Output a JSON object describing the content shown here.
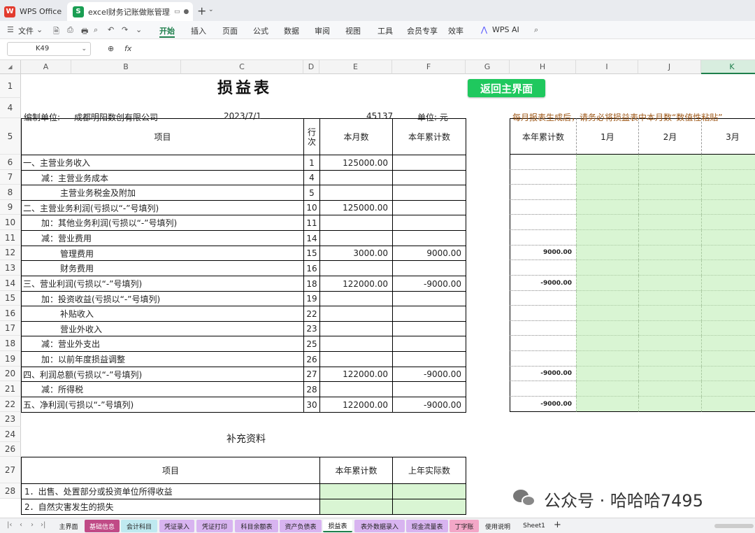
{
  "titlebar": {
    "app_tab": "WPS Office",
    "app_logo": "W",
    "doc_logo": "S",
    "doc_tab": "excel财务记账做账管理系统",
    "icons": [
      "monitor-icon",
      "dot-icon",
      "plus-icon",
      "chevron-down-icon"
    ]
  },
  "menu": {
    "file": "文件",
    "items": [
      "开始",
      "插入",
      "页面",
      "公式",
      "数据",
      "审阅",
      "视图",
      "工具",
      "会员专享",
      "效率",
      "WPS AI"
    ],
    "active": "开始"
  },
  "formula": {
    "cell_ref": "K49",
    "fx": "fx"
  },
  "columns": [
    "A",
    "B",
    "C",
    "D",
    "E",
    "F",
    "G",
    "H",
    "I",
    "J",
    "K"
  ],
  "selected_column": "K",
  "rows": [
    "1",
    "4",
    "5",
    "6",
    "7",
    "8",
    "9",
    "10",
    "11",
    "12",
    "13",
    "14",
    "15",
    "16",
    "17",
    "18",
    "19",
    "20",
    "21",
    "22",
    "23",
    "24",
    "26",
    "27",
    "28"
  ],
  "sheet": {
    "title": "损益表",
    "back_button": "返回主界面",
    "company_label": "编制单位:",
    "company": "成都明阳数创有限公司",
    "date": "2023/7/1",
    "serial": "45137",
    "unit": "单位: 元",
    "notice": "每月报表生成后，请务必将损益表中本月数“数值性粘贴”",
    "headers": {
      "item": "项目",
      "line": "行次",
      "month": "本月数",
      "ytd": "本年累计数"
    },
    "right_headers": [
      "本年累计数",
      "1月",
      "2月",
      "3月"
    ],
    "lines": [
      {
        "item": "一、主营业务收入",
        "indent": 0,
        "line": "1",
        "month": "125000.00",
        "ytd": ""
      },
      {
        "item": "减：主营业务成本",
        "indent": 1,
        "line": "4",
        "month": "",
        "ytd": ""
      },
      {
        "item": "主营业务税金及附加",
        "indent": 2,
        "line": "5",
        "month": "",
        "ytd": ""
      },
      {
        "item": "二、主营业务利润(亏损以“-”号填列)",
        "indent": 0,
        "line": "10",
        "month": "125000.00",
        "ytd": ""
      },
      {
        "item": "加：其他业务利润(亏损以“-”号填列)",
        "indent": 1,
        "line": "11",
        "month": "",
        "ytd": ""
      },
      {
        "item": "减：营业费用",
        "indent": 1,
        "line": "14",
        "month": "",
        "ytd": ""
      },
      {
        "item": "管理费用",
        "indent": 2,
        "line": "15",
        "month": "3000.00",
        "ytd": "9000.00"
      },
      {
        "item": "财务费用",
        "indent": 2,
        "line": "16",
        "month": "",
        "ytd": ""
      },
      {
        "item": "三、营业利润(亏损以“-”号填列)",
        "indent": 0,
        "line": "18",
        "month": "122000.00",
        "ytd": "-9000.00"
      },
      {
        "item": "加：投资收益(亏损以“-”号填列)",
        "indent": 1,
        "line": "19",
        "month": "",
        "ytd": ""
      },
      {
        "item": "补贴收入",
        "indent": 2,
        "line": "22",
        "month": "",
        "ytd": ""
      },
      {
        "item": "营业外收入",
        "indent": 2,
        "line": "23",
        "month": "",
        "ytd": ""
      },
      {
        "item": "减：营业外支出",
        "indent": 1,
        "line": "25",
        "month": "",
        "ytd": ""
      },
      {
        "item": "加：以前年度损益调整",
        "indent": 1,
        "line": "26",
        "month": "",
        "ytd": ""
      },
      {
        "item": "四、利润总额(亏损以“-”号填列)",
        "indent": 0,
        "line": "27",
        "month": "122000.00",
        "ytd": "-9000.00"
      },
      {
        "item": "减：所得税",
        "indent": 1,
        "line": "28",
        "month": "",
        "ytd": ""
      },
      {
        "item": "五、净利润(亏损以“-”号填列)",
        "indent": 0,
        "line": "30",
        "month": "122000.00",
        "ytd": "-9000.00"
      }
    ],
    "right_ytd": [
      "",
      "",
      "",
      "",
      "",
      "",
      "9000.00",
      "",
      "-9000.00",
      "",
      "",
      "",
      "",
      "",
      "-9000.00",
      "",
      "-9000.00"
    ],
    "supplement_title": "补充资料",
    "supplement_headers": {
      "item": "项目",
      "ytd": "本年累计数",
      "prev": "上年实际数"
    },
    "supplement_items": [
      "1．出售、处置部分或投资单位所得收益",
      "2．自然灾害发生的损失"
    ]
  },
  "watermark": "公众号 · 哈哈哈7495",
  "sheet_tabs": [
    {
      "label": "主界面",
      "color": "#f1f2f4"
    },
    {
      "label": "基础信息",
      "color": "#c04a86"
    },
    {
      "label": "会计科目",
      "color": "#bfe9f0"
    },
    {
      "label": "凭证录入",
      "color": "#d8b4f0"
    },
    {
      "label": "凭证打印",
      "color": "#d8b4f0"
    },
    {
      "label": "科目余额表",
      "color": "#d8b4f0"
    },
    {
      "label": "资产负债表",
      "color": "#d8b4f0"
    },
    {
      "label": "损益表",
      "color": "#ffffff"
    },
    {
      "label": "表外数据录入",
      "color": "#d8b4f0"
    },
    {
      "label": "现金流量表",
      "color": "#d8b4f0"
    },
    {
      "label": "丁字账",
      "color": "#f3a7c7"
    },
    {
      "label": "使用说明",
      "color": "#f1f2f4"
    },
    {
      "label": "Sheet1",
      "color": "#f1f2f4"
    }
  ]
}
